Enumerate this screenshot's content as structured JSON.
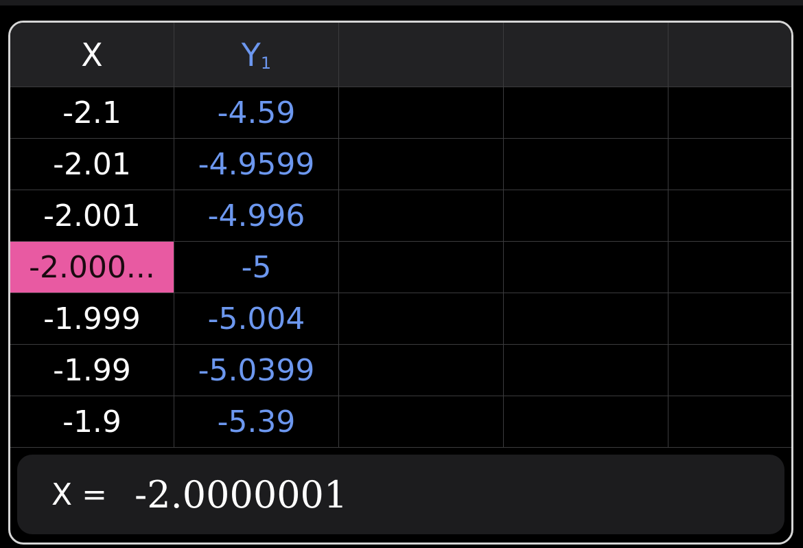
{
  "table": {
    "headers": {
      "x": "X",
      "y_main": "Y",
      "y_sub": "1"
    },
    "rows": [
      {
        "x": "-2.1",
        "y": "-4.59"
      },
      {
        "x": "-2.01",
        "y": "-4.9599"
      },
      {
        "x": "-2.001",
        "y": "-4.996"
      },
      {
        "x": "-2.000...",
        "y": "-5"
      },
      {
        "x": "-1.999",
        "y": "-5.004"
      },
      {
        "x": "-1.99",
        "y": "-5.0399"
      },
      {
        "x": "-1.9",
        "y": "-5.39"
      }
    ],
    "selected_row": 3
  },
  "editor": {
    "label": "X =",
    "value": "-2.0000001"
  },
  "colors": {
    "background": "#000000",
    "header_bg": "#222224",
    "y_text": "#6c97ef",
    "selection": "#e85aa2",
    "editor_bg": "#1c1c1e"
  }
}
